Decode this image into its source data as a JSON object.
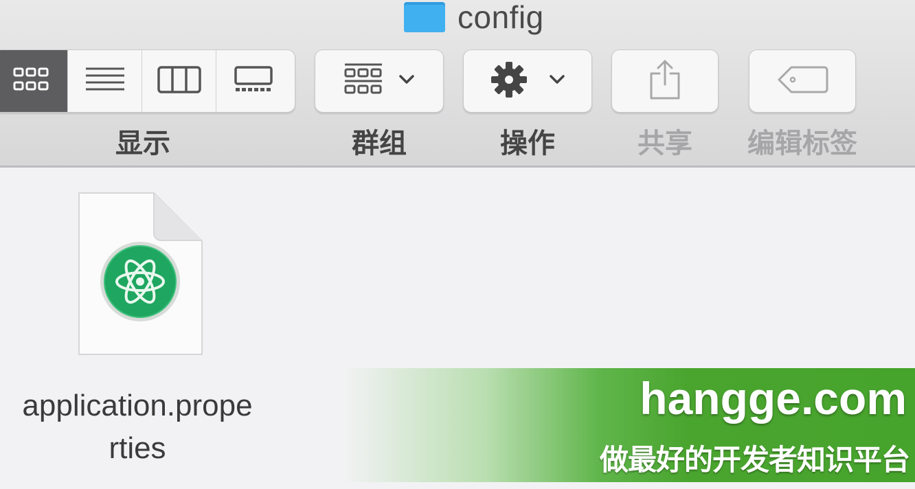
{
  "window": {
    "title": "config",
    "folder_icon": "folder-icon"
  },
  "toolbar": {
    "view": {
      "label": "显示",
      "buttons": [
        {
          "icon": "icon-view-icon",
          "active": true
        },
        {
          "icon": "list-view-icon",
          "active": false
        },
        {
          "icon": "column-view-icon",
          "active": false
        },
        {
          "icon": "gallery-view-icon",
          "active": false
        }
      ]
    },
    "group": {
      "label": "群组",
      "icon": "group-grid-icon"
    },
    "action": {
      "label": "操作",
      "icon": "gear-icon"
    },
    "share": {
      "label": "共享",
      "icon": "share-icon"
    },
    "tags": {
      "label": "编辑标签",
      "icon": "tag-icon"
    }
  },
  "files": [
    {
      "name": "application.prope\nrties",
      "icon": "atom-editor-icon"
    }
  ],
  "watermark": {
    "domain": "hangge.com",
    "slogan": "做最好的开发者知识平台"
  },
  "colors": {
    "active_segment": "#5d5d5f",
    "folder": "#39a8ea",
    "atom_green": "#1fa660",
    "watermark_green": "#46a32c"
  }
}
